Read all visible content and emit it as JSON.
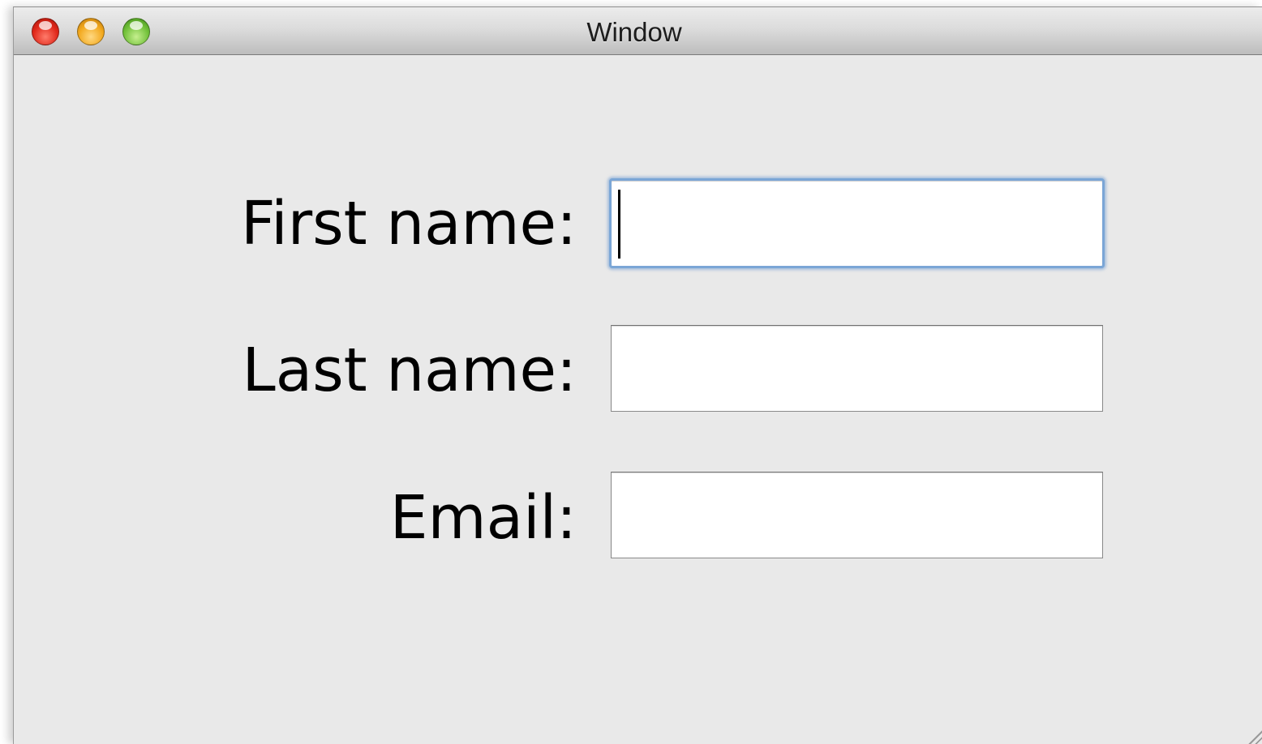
{
  "window": {
    "title": "Window"
  },
  "titlebar": {
    "buttons": [
      {
        "name": "close",
        "color": "#e0281a"
      },
      {
        "name": "minimize",
        "color": "#f2a81d"
      },
      {
        "name": "zoom",
        "color": "#72c13a"
      }
    ]
  },
  "form": {
    "first_name_label": "First name:",
    "first_name_value": "",
    "last_name_label": "Last name:",
    "last_name_value": "",
    "email_label": "Email:",
    "email_value": ""
  },
  "colors": {
    "focus_ring": "#7ba6d6",
    "window_bg": "#e9e9e9"
  }
}
